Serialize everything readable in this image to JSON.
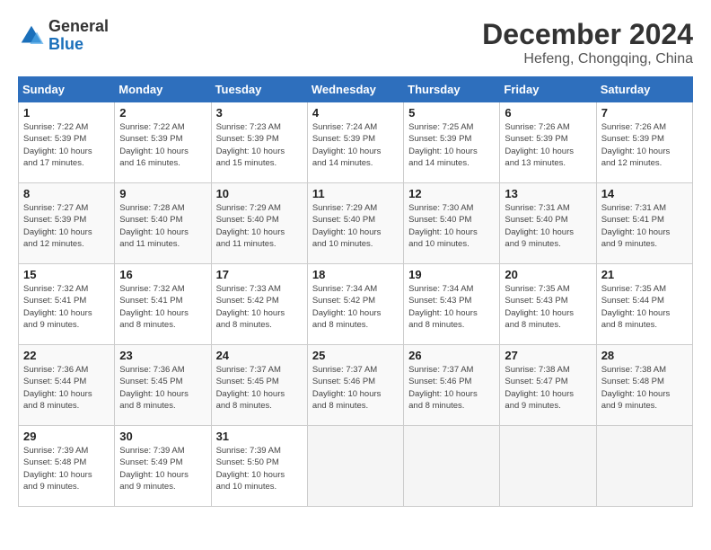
{
  "logo": {
    "line1": "General",
    "line2": "Blue"
  },
  "title": "December 2024",
  "location": "Hefeng, Chongqing, China",
  "weekdays": [
    "Sunday",
    "Monday",
    "Tuesday",
    "Wednesday",
    "Thursday",
    "Friday",
    "Saturday"
  ],
  "weeks": [
    [
      {
        "day": "1",
        "info": "Sunrise: 7:22 AM\nSunset: 5:39 PM\nDaylight: 10 hours\nand 17 minutes."
      },
      {
        "day": "2",
        "info": "Sunrise: 7:22 AM\nSunset: 5:39 PM\nDaylight: 10 hours\nand 16 minutes."
      },
      {
        "day": "3",
        "info": "Sunrise: 7:23 AM\nSunset: 5:39 PM\nDaylight: 10 hours\nand 15 minutes."
      },
      {
        "day": "4",
        "info": "Sunrise: 7:24 AM\nSunset: 5:39 PM\nDaylight: 10 hours\nand 14 minutes."
      },
      {
        "day": "5",
        "info": "Sunrise: 7:25 AM\nSunset: 5:39 PM\nDaylight: 10 hours\nand 14 minutes."
      },
      {
        "day": "6",
        "info": "Sunrise: 7:26 AM\nSunset: 5:39 PM\nDaylight: 10 hours\nand 13 minutes."
      },
      {
        "day": "7",
        "info": "Sunrise: 7:26 AM\nSunset: 5:39 PM\nDaylight: 10 hours\nand 12 minutes."
      }
    ],
    [
      {
        "day": "8",
        "info": "Sunrise: 7:27 AM\nSunset: 5:39 PM\nDaylight: 10 hours\nand 12 minutes."
      },
      {
        "day": "9",
        "info": "Sunrise: 7:28 AM\nSunset: 5:40 PM\nDaylight: 10 hours\nand 11 minutes."
      },
      {
        "day": "10",
        "info": "Sunrise: 7:29 AM\nSunset: 5:40 PM\nDaylight: 10 hours\nand 11 minutes."
      },
      {
        "day": "11",
        "info": "Sunrise: 7:29 AM\nSunset: 5:40 PM\nDaylight: 10 hours\nand 10 minutes."
      },
      {
        "day": "12",
        "info": "Sunrise: 7:30 AM\nSunset: 5:40 PM\nDaylight: 10 hours\nand 10 minutes."
      },
      {
        "day": "13",
        "info": "Sunrise: 7:31 AM\nSunset: 5:40 PM\nDaylight: 10 hours\nand 9 minutes."
      },
      {
        "day": "14",
        "info": "Sunrise: 7:31 AM\nSunset: 5:41 PM\nDaylight: 10 hours\nand 9 minutes."
      }
    ],
    [
      {
        "day": "15",
        "info": "Sunrise: 7:32 AM\nSunset: 5:41 PM\nDaylight: 10 hours\nand 9 minutes."
      },
      {
        "day": "16",
        "info": "Sunrise: 7:32 AM\nSunset: 5:41 PM\nDaylight: 10 hours\nand 8 minutes."
      },
      {
        "day": "17",
        "info": "Sunrise: 7:33 AM\nSunset: 5:42 PM\nDaylight: 10 hours\nand 8 minutes."
      },
      {
        "day": "18",
        "info": "Sunrise: 7:34 AM\nSunset: 5:42 PM\nDaylight: 10 hours\nand 8 minutes."
      },
      {
        "day": "19",
        "info": "Sunrise: 7:34 AM\nSunset: 5:43 PM\nDaylight: 10 hours\nand 8 minutes."
      },
      {
        "day": "20",
        "info": "Sunrise: 7:35 AM\nSunset: 5:43 PM\nDaylight: 10 hours\nand 8 minutes."
      },
      {
        "day": "21",
        "info": "Sunrise: 7:35 AM\nSunset: 5:44 PM\nDaylight: 10 hours\nand 8 minutes."
      }
    ],
    [
      {
        "day": "22",
        "info": "Sunrise: 7:36 AM\nSunset: 5:44 PM\nDaylight: 10 hours\nand 8 minutes."
      },
      {
        "day": "23",
        "info": "Sunrise: 7:36 AM\nSunset: 5:45 PM\nDaylight: 10 hours\nand 8 minutes."
      },
      {
        "day": "24",
        "info": "Sunrise: 7:37 AM\nSunset: 5:45 PM\nDaylight: 10 hours\nand 8 minutes."
      },
      {
        "day": "25",
        "info": "Sunrise: 7:37 AM\nSunset: 5:46 PM\nDaylight: 10 hours\nand 8 minutes."
      },
      {
        "day": "26",
        "info": "Sunrise: 7:37 AM\nSunset: 5:46 PM\nDaylight: 10 hours\nand 8 minutes."
      },
      {
        "day": "27",
        "info": "Sunrise: 7:38 AM\nSunset: 5:47 PM\nDaylight: 10 hours\nand 9 minutes."
      },
      {
        "day": "28",
        "info": "Sunrise: 7:38 AM\nSunset: 5:48 PM\nDaylight: 10 hours\nand 9 minutes."
      }
    ],
    [
      {
        "day": "29",
        "info": "Sunrise: 7:39 AM\nSunset: 5:48 PM\nDaylight: 10 hours\nand 9 minutes."
      },
      {
        "day": "30",
        "info": "Sunrise: 7:39 AM\nSunset: 5:49 PM\nDaylight: 10 hours\nand 9 minutes."
      },
      {
        "day": "31",
        "info": "Sunrise: 7:39 AM\nSunset: 5:50 PM\nDaylight: 10 hours\nand 10 minutes."
      },
      {
        "day": "",
        "info": ""
      },
      {
        "day": "",
        "info": ""
      },
      {
        "day": "",
        "info": ""
      },
      {
        "day": "",
        "info": ""
      }
    ]
  ]
}
